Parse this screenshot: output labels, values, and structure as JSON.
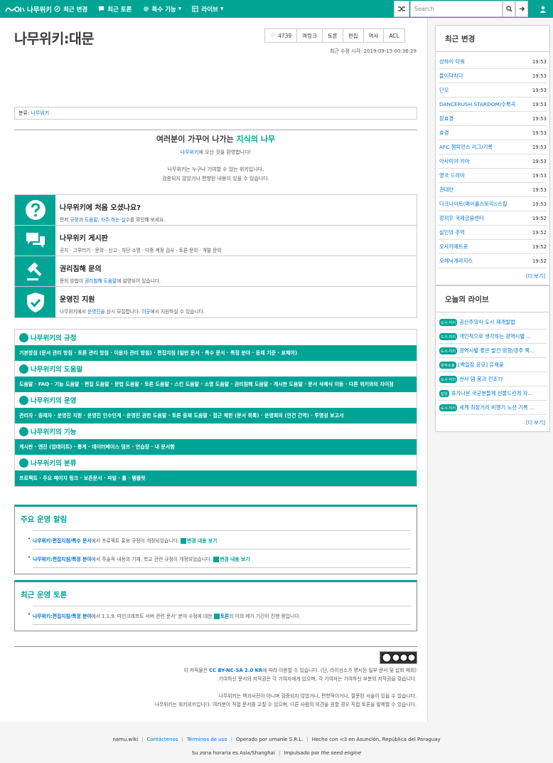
{
  "nav": {
    "brand": "나무위키",
    "items": [
      {
        "label": "최근 변경",
        "icon": "compass-icon"
      },
      {
        "label": "최근 토론",
        "icon": "comment-icon"
      },
      {
        "label": "특수 기능",
        "icon": "gear-icon",
        "dropdown": true
      },
      {
        "label": "라이브",
        "icon": "grid-icon",
        "dropdown": true
      }
    ],
    "search_placeholder": "Search"
  },
  "page": {
    "title": "나무위키:대문",
    "star_count": "4739",
    "tools": [
      "역링크",
      "토론",
      "편집",
      "역사",
      "ACL"
    ],
    "last_edit": "최근 수정 시각: 2019-09-15 00:36:29",
    "category_label": "분류:",
    "category": "나무위키"
  },
  "welcome": {
    "title_pre": "여러분이 가꾸어 나가는 ",
    "title_em": "지식의 나무",
    "sub_link": "나무위키",
    "sub_text": "에 오신 것을 환영합니다!",
    "line1": "나무위키는 누구나 기여할 수 있는 위키입니다.",
    "line2": "검증되지 않았거나 편향된 내용이 있을 수 있습니다."
  },
  "info": [
    {
      "icon": "question-icon",
      "title": "나무위키에 처음 오셨나요?",
      "d1": "먼저 ",
      "l1": "규정",
      "d2": "과 ",
      "l2": "도움말, 자주 하는 실수",
      "d3": "를 확인해 보세요."
    },
    {
      "icon": "chat-icon",
      "title": "나무위키 게시판",
      "links": "공지 · 그루터기 · 문의 · 신고 · 차단 소명 · 다중 계정 검사 · 토론 문의 · 개발 문의"
    },
    {
      "icon": "gavel-icon",
      "title": "권리침해 문의",
      "d1": "문의 방법이 ",
      "l1": "권리침해 도움말",
      "d2": "에 설명되어 있습니다."
    },
    {
      "icon": "shield-check-icon",
      "title": "운영진 지원",
      "d1": "나무위키에서 ",
      "l1": "운영진",
      "d2": "을 상시 모집합니다. ",
      "l2": "이곳",
      "d3": "에서 지원하실 수 있습니다."
    }
  ],
  "rules": [
    {
      "title": "나무위키의 규정",
      "body": "기본방침 (문서 관리 방침 · 토론 관리 방침 · 이용자 관리 방침) · 편집지침 (일반 문서 · 특수 문서 · 특정 분야 · 등재 기준 · 표제어)"
    },
    {
      "title": "나무위키의 도움말",
      "body": "도움말 · FAQ · 기능 도움말 · 편집 도움말 · 문법 도움말 · 토론 도움말 · 스킨 도움말 · 소명 도움말 · 권리침해 도움말 · 게시판 도움말 · 문서 삭제식 이동 · 다른 위키와의 차이점"
    },
    {
      "title": "나무위키의 운영",
      "body": "관리자 · 중재자 · 운영진 지원 · 운영진 인수인계 · 운영진 권한 도움말 · 토론 중재 도움말 · 접근 제한 (문서 목록) · 운영회의 (안건 간역) · 투명성 보고서"
    },
    {
      "title": "나무위키의 기능",
      "body": "게시판 · 엔진 (업데이트) · 통계 · 데이터베이스 덤프 · 연습장 · 내 문서함"
    },
    {
      "title": "나무위키의 분류",
      "body": "프로젝트 · 주요 페이지 링크 · 보존문서 · 파일 · 틀 · 템플릿"
    }
  ],
  "notice": {
    "title": "주요 운영 알림",
    "items": [
      {
        "link": "나무위키:편집지침/특수 문서",
        "text": "에서 프로젝트 홍보 규정이 개정되었습니다. ",
        "diff": "변경 내용 보기"
      },
      {
        "link": "나무위키:편집지침/특정 분야",
        "text": "에서 주술적 내용의 기재, 학교 관련 규정이 개정되었습니다. ",
        "diff": "변경 내용 보기"
      }
    ]
  },
  "discussion": {
    "title": "최근 운영 토론",
    "items": [
      {
        "link": "나무위키:편집지침/특정 분야",
        "text1": "에서 1.1.9. 마인크래프트 서버 관련 문서' 분야 수정에 대한 ",
        "link2": "토론",
        "text2": "의 이의 제기 기간이 진행 중입니다."
      }
    ]
  },
  "license": {
    "pre": "이 저작물은 ",
    "cc": "CC BY-NC-SA 2.0 KR",
    "post": "에 따라 이용할 수 있습니다. (단, 라이선스가 명시된 일부 문서 및 삽화 제외)",
    "l2": "기여하신 문서의 저작권은 각 기여자에게 있으며, 각 기여자는 기여하신 부분의 저작권을 갖습니다.",
    "l3": "나무위키는 백과사전이 아니며 검증되지 않았거나, 편향적이거나, 잘못된 서술이 있을 수 있습니다.",
    "l4": "나무위키는 위키위키입니다. 여러분이 직접 문서를 고칠 수 있으며, 다른 사람의 의견을 원할 경우 직접 토론을 발제할 수 있습니다."
  },
  "recent": {
    "title": "최근 변경",
    "more": "[더 보기]",
    "items": [
      {
        "name": "상하이 타워",
        "time": "19:53"
      },
      {
        "name": "들이닥치다",
        "time": "19:53"
      },
      {
        "name": "단오",
        "time": "19:53"
      },
      {
        "name": "DANCERUSH STARDOM/수록곡",
        "time": "19:53"
      },
      {
        "name": "장효경",
        "time": "19:53"
      },
      {
        "name": "효경",
        "time": "19:53"
      },
      {
        "name": "AFC 챔피언스 리그/기록",
        "time": "19:53"
      },
      {
        "name": "아사미야 키아",
        "time": "19:53"
      },
      {
        "name": "영국 드라마",
        "time": "19:53"
      },
      {
        "name": "권대만",
        "time": "19:53"
      },
      {
        "name": "다크나이트(메이플스토리)/스킬",
        "time": "19:53"
      },
      {
        "name": "광저우 국제금융센터",
        "time": "19:52"
      },
      {
        "name": "살인의 추억",
        "time": "19:52"
      },
      {
        "name": "오사카메트로",
        "time": "19:52"
      },
      {
        "name": "모헤닉게라지스",
        "time": "19:52"
      }
    ]
  },
  "live": {
    "title": "오늘의 라이브",
    "more": "[더 보기]",
    "items": [
      {
        "badge": "도시·지리",
        "name": "공산주의식 도시 재개발법"
      },
      {
        "badge": "도시·지리",
        "name": "개인적으로 생각하는 광역시별 ..."
      },
      {
        "badge": "도시·지리",
        "name": "광역시별 좋은 발전 방향/광주 쪽..."
      },
      {
        "badge": "창작소설",
        "name": "[백일장 응모] 유채꽃"
      },
      {
        "badge": "도시·지리",
        "name": "싼샤 댐 붕괴 전조??"
      },
      {
        "badge": "잡담",
        "name": "휴가나온 국군분들께 선물드린게 자..."
      },
      {
        "badge": "도시·지리",
        "name": "세계 최장거리 비행기 노선 기록 ..."
      }
    ]
  },
  "bottom": {
    "site": "namu.wiki",
    "contact": "Contáctenos",
    "terms": "Términos de uso",
    "operated": "Operado por umanle S.R.L.",
    "made": "Hecho con <3 en Asunción, República del Paraguay",
    "tz": "Su zona horaria es Asia/Shanghai",
    "powered_pre": "Impulsado por ",
    "powered_em": "the seed engine"
  },
  "colors": {
    "accent": "#00a495",
    "link": "#0275d8"
  }
}
